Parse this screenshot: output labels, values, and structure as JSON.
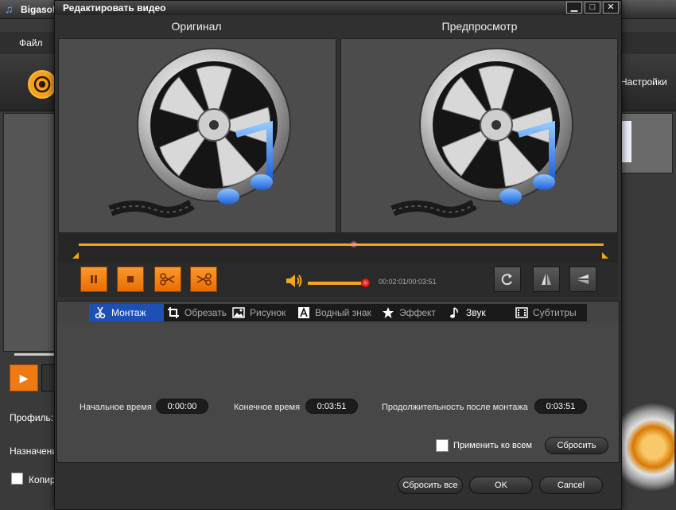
{
  "background_app": {
    "title": "Bigasoft",
    "menu_file": "Файл",
    "settings_label": "Настройки",
    "profile_label": "Профиль:",
    "destination_label": "Назначени",
    "copy_label": "Копир"
  },
  "dialog": {
    "title": "Редактировать видео",
    "original_label": "Оригинал",
    "preview_label": "Предпросмотр",
    "window_buttons": {
      "minimize": "▁",
      "maximize": "□",
      "close": "✕"
    }
  },
  "playback": {
    "time_readout": "00:02:01/00:03:51",
    "volume_fraction": 0.92,
    "position_fraction": 0.524
  },
  "tabs": [
    {
      "label": "Монтаж",
      "icon": "scissors-icon",
      "active": true
    },
    {
      "label": "Обрезать",
      "icon": "crop-icon",
      "active": false
    },
    {
      "label": "Рисунок",
      "icon": "picture-icon",
      "active": false
    },
    {
      "label": "Водный знак",
      "icon": "watermark-icon",
      "active": false
    },
    {
      "label": "Эффект",
      "icon": "star-icon",
      "active": false
    },
    {
      "label": "Звук",
      "icon": "music-note-icon",
      "active": false
    },
    {
      "label": "Субтитры",
      "icon": "subtitles-icon",
      "active": false
    }
  ],
  "trim": {
    "start_label": "Начальное время",
    "start_value": "0:00:00",
    "end_label": "Конечное время",
    "end_value": "0:03:51",
    "duration_label": "Продолжительность после монтажа",
    "duration_value": "0:03:51",
    "apply_all_label": "Применить ко всем",
    "reset_label": "Сбросить"
  },
  "footer": {
    "reset_all_label": "Сбросить все",
    "ok_label": "OK",
    "cancel_label": "Cancel"
  },
  "colors": {
    "accent_orange": "#f3a61f",
    "active_tab_blue": "#1d4fb5",
    "panel_dark": "#303030"
  }
}
